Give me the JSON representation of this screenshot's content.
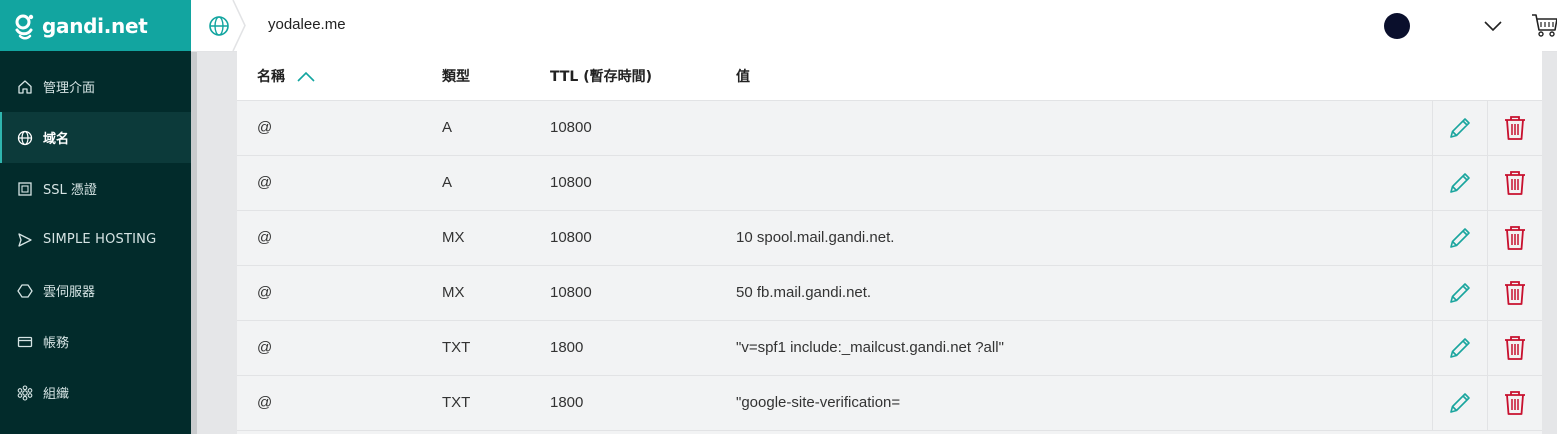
{
  "brand": {
    "name": "gandi.net",
    "color": "#12a5a0"
  },
  "sidebar": {
    "items": [
      {
        "label": "管理介面",
        "icon": "home-icon",
        "active": false
      },
      {
        "label": "域名",
        "icon": "globe-icon",
        "active": true
      },
      {
        "label": "SSL 憑證",
        "icon": "certificate-icon",
        "active": false
      },
      {
        "label": "SIMPLE HOSTING",
        "icon": "send-icon",
        "active": false
      },
      {
        "label": "雲伺服器",
        "icon": "hexagon-icon",
        "active": false
      },
      {
        "label": "帳務",
        "icon": "credit-card-icon",
        "active": false
      },
      {
        "label": "組織",
        "icon": "organization-icon",
        "active": false
      }
    ]
  },
  "topbar": {
    "domain": "yodalee.me",
    "icons": [
      "globe-icon",
      "avatar",
      "chevron-down-icon",
      "cart-icon"
    ]
  },
  "table": {
    "headers": {
      "name": "名稱",
      "type": "類型",
      "ttl": "TTL (暫存時間)",
      "value": "值"
    },
    "sort": {
      "column": "name",
      "direction": "ascending"
    },
    "rows": [
      {
        "name": "@",
        "type": "A",
        "ttl": "10800",
        "value": ""
      },
      {
        "name": "@",
        "type": "A",
        "ttl": "10800",
        "value": ""
      },
      {
        "name": "@",
        "type": "MX",
        "ttl": "10800",
        "value": "10 spool.mail.gandi.net."
      },
      {
        "name": "@",
        "type": "MX",
        "ttl": "10800",
        "value": "50 fb.mail.gandi.net."
      },
      {
        "name": "@",
        "type": "TXT",
        "ttl": "1800",
        "value": "\"v=spf1 include:_mailcust.gandi.net ?all\""
      },
      {
        "name": "@",
        "type": "TXT",
        "ttl": "1800",
        "value": "\"google-site-verification="
      }
    ]
  },
  "colors": {
    "accent": "#12a5a0",
    "edit": "#1aa59e",
    "delete": "#c8102e",
    "sidebar_bg": "#022b2b"
  }
}
